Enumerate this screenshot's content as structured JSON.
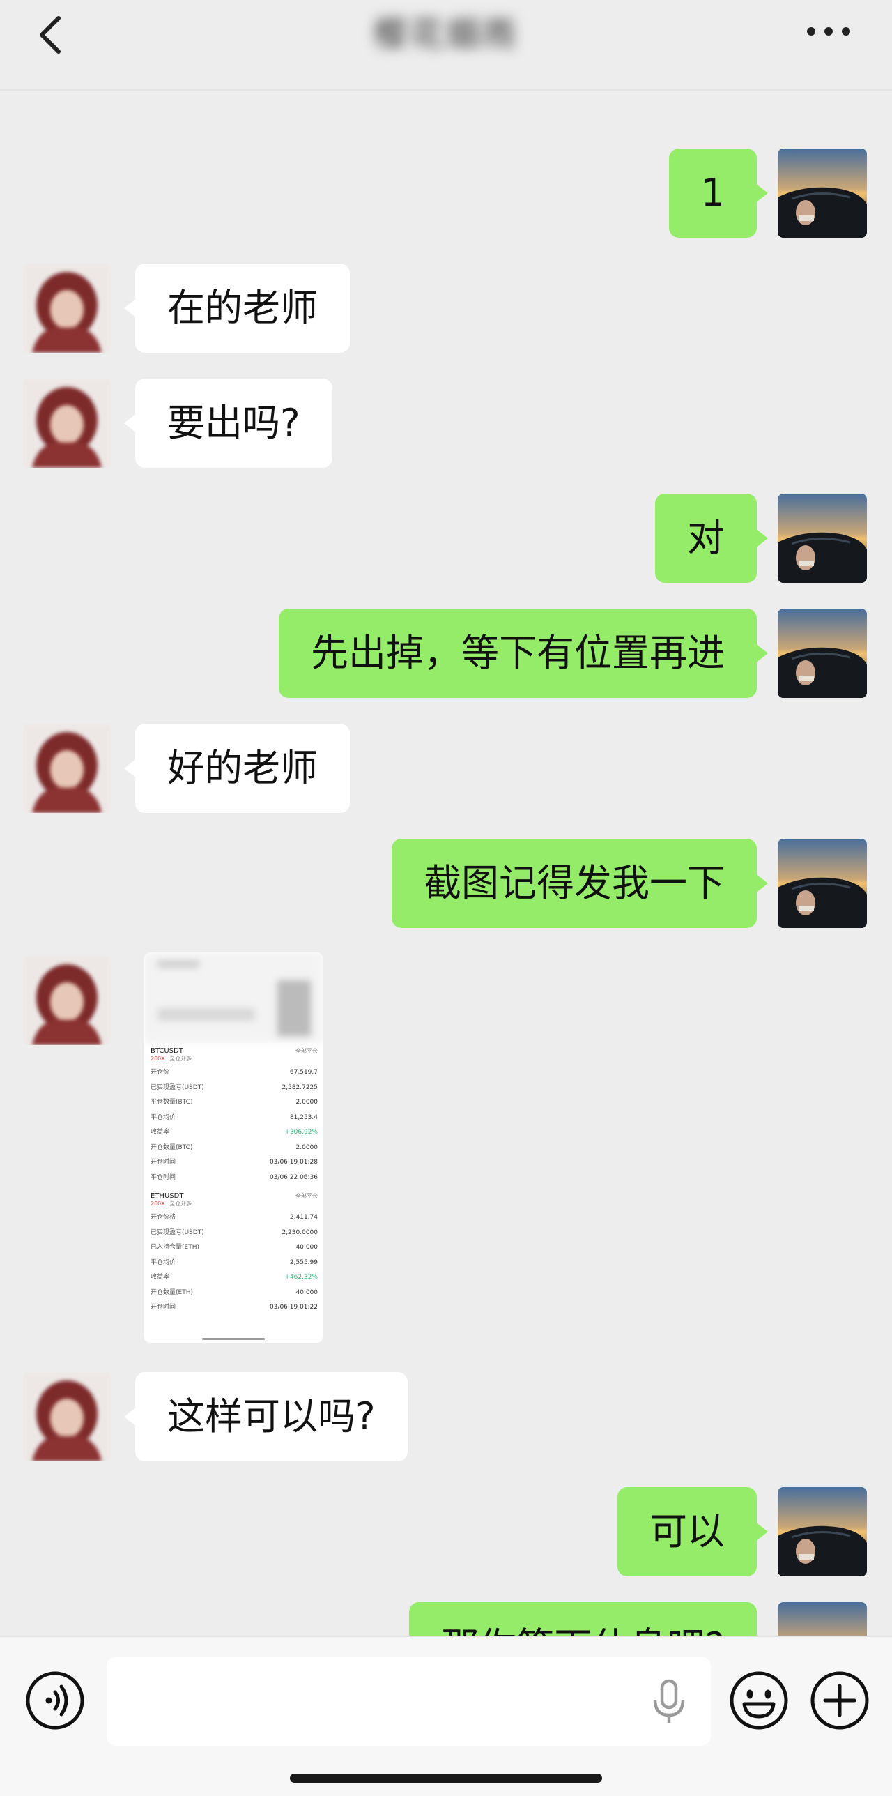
{
  "header": {
    "title": "樱花烟雨",
    "back_icon": "chevron-left-icon",
    "more_icon": "more-dots-icon"
  },
  "messages": [
    {
      "from": "me",
      "text": "1"
    },
    {
      "from": "other",
      "text": "在的老师"
    },
    {
      "from": "other",
      "text": "要出吗?"
    },
    {
      "from": "me",
      "text": "对"
    },
    {
      "from": "me",
      "text": "先出掉，等下有位置再进"
    },
    {
      "from": "other",
      "text": "好的老师"
    },
    {
      "from": "me",
      "text": "截图记得发我一下"
    },
    {
      "from": "other",
      "type": "image"
    },
    {
      "from": "other",
      "text": "这样可以吗?"
    },
    {
      "from": "me",
      "text": "可以"
    },
    {
      "from": "me",
      "text": "那你等下休息吧?"
    }
  ],
  "screenshot": {
    "pos1": {
      "symbol": "BTCUSDT",
      "link": "全部平仓",
      "leverage": "200X",
      "mode": "全仓开多",
      "rows": [
        {
          "label": "开仓价",
          "value": "67,519.7"
        },
        {
          "label": "已实现盈亏(USDT)",
          "value": "2,582.7225"
        },
        {
          "label": "平仓数量(BTC)",
          "value": "2.0000"
        },
        {
          "label": "平仓均价",
          "value": "81,253.4"
        },
        {
          "label": "收益率",
          "value": "+306.92%",
          "green": true
        },
        {
          "label": "开仓数量(BTC)",
          "value": "2.0000"
        },
        {
          "label": "开仓时间",
          "value": "03/06 19 01:28"
        },
        {
          "label": "平仓时间",
          "value": "03/06 22 06:36"
        }
      ]
    },
    "pos2": {
      "symbol": "ETHUSDT",
      "link": "全部平仓",
      "leverage": "200X",
      "mode": "全仓开多",
      "rows": [
        {
          "label": "开仓价格",
          "value": "2,411.74"
        },
        {
          "label": "已实现盈亏(USDT)",
          "value": "2,230.0000"
        },
        {
          "label": "已入持仓量(ETH)",
          "value": "40.000"
        },
        {
          "label": "平仓均价",
          "value": "2,555.99"
        },
        {
          "label": "收益率",
          "value": "+462.32%",
          "green": true
        },
        {
          "label": "开仓数量(ETH)",
          "value": "40.000"
        },
        {
          "label": "开仓时间",
          "value": "03/06 19 01:22"
        }
      ]
    }
  },
  "input_bar": {
    "placeholder": "",
    "voice_icon": "voice-input-icon",
    "mic_icon": "mic-icon",
    "emoji_icon": "emoji-icon",
    "plus_icon": "plus-circle-icon"
  }
}
